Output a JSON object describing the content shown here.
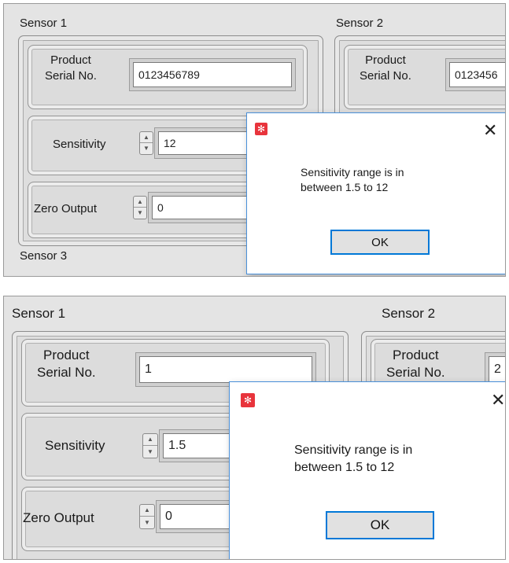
{
  "top": {
    "sensor1_label": "Sensor 1",
    "sensor2_label": "Sensor 2",
    "sensor3_label": "Sensor 3",
    "serial_label_line1": "Product",
    "serial_label_line2": "Serial No.",
    "serial_value": "0123456789",
    "sensor2_serial_label_line1": "Product",
    "sensor2_serial_label_line2": "Serial No.",
    "sensor2_serial_value": "0123456",
    "sensitivity_label": "Sensitivity",
    "sensitivity_value": "12",
    "zero_output_label": "Zero Output",
    "zero_output_value": "0",
    "dialog": {
      "message_line1": "Sensitivity range is in",
      "message_line2": "between 1.5 to 12",
      "ok_label": "OK",
      "close_glyph": "✕"
    }
  },
  "bottom": {
    "sensor1_label": "Sensor 1",
    "sensor2_label": "Sensor 2",
    "serial_label_line1": "Product",
    "serial_label_line2": "Serial No.",
    "serial_value": "1",
    "sensor2_serial_label_line1": "Product",
    "sensor2_serial_label_line2": "Serial No.",
    "sensor2_serial_value": "2",
    "sensitivity_label": "Sensitivity",
    "sensitivity_value": "1.5",
    "zero_output_label": "Zero Output",
    "zero_output_value": "0",
    "dialog": {
      "message_line1": "Sensitivity range is in",
      "message_line2": "between 1.5 to 12",
      "ok_label": "OK",
      "close_glyph": "✕"
    }
  },
  "colors": {
    "dialog_border": "#4a90d9",
    "ok_focus_border": "#0078d7",
    "app_icon": "#e8343c",
    "panel_bg": "#dedede"
  },
  "icons": [
    "app-icon",
    "close-icon",
    "spin-up-icon",
    "spin-down-icon"
  ]
}
